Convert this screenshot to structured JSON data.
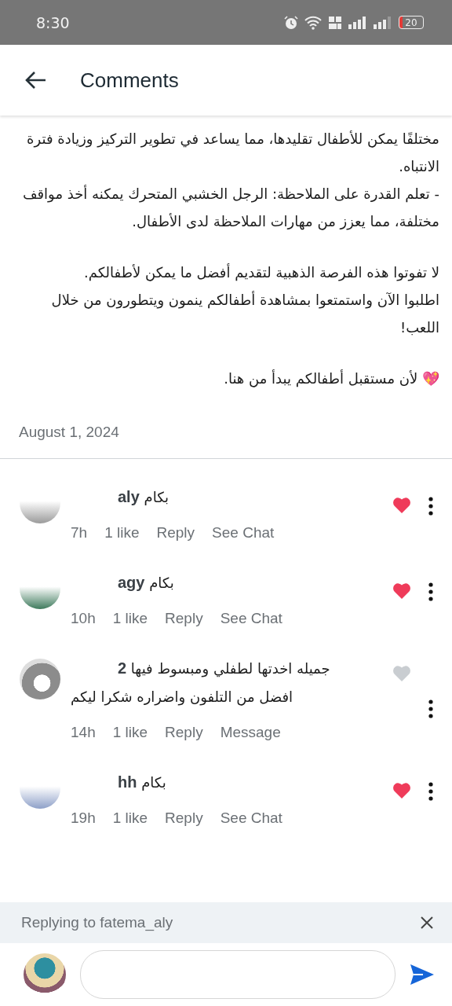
{
  "status_bar": {
    "time": "8:30",
    "battery": "20"
  },
  "header": {
    "title": "Comments"
  },
  "post": {
    "blocks": [
      [
        "مختلفًا يمكن للأطفال تقليدها، مما يساعد في تطوير التركيز وزيادة فترة الانتباه.",
        "- تعلم القدرة على الملاحظة: الرجل الخشبي المتحرك يمكنه أخذ مواقف مختلفة، مما يعزز من مهارات الملاحظة لدى الأطفال."
      ],
      [
        "لا تفوتوا هذه الفرصة الذهبية لتقديم أفضل ما يمكن لأطفالكم.",
        "اطلبوا الآن واستمتعوا بمشاهدة أطفالكم ينمون ويتطورون من خلال اللعب!"
      ],
      [
        "💖 لأن مستقبل أطفالكم يبدأ من هنا."
      ]
    ],
    "date": "August 1, 2024"
  },
  "comments": [
    {
      "username": "aly",
      "text": "بكام",
      "time": "7h",
      "likes": "1 like",
      "reply": "Reply",
      "action": "See Chat",
      "liked": true
    },
    {
      "username": "agy",
      "text": "بكام",
      "time": "10h",
      "likes": "1 like",
      "reply": "Reply",
      "action": "See Chat",
      "liked": true
    },
    {
      "username": "2",
      "text": "جميله اخدتها لطفلي ومبسوط فيها افضل من التلفون واضراره شكرا ليكم",
      "time": "14h",
      "likes": "1 like",
      "reply": "Reply",
      "action": "Message",
      "liked": false
    },
    {
      "username": "hh",
      "text": "بكام",
      "time": "19h",
      "likes": "1 like",
      "reply": "Reply",
      "action": "See Chat",
      "liked": true
    }
  ],
  "reply_bar": {
    "text": "Replying to fatema_aly"
  }
}
